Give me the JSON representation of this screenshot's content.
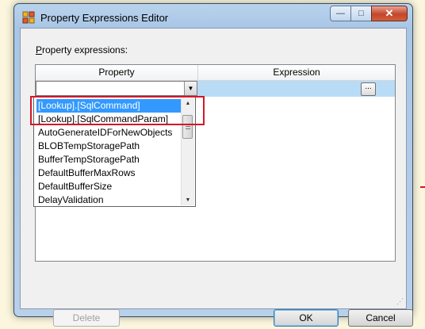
{
  "window": {
    "title": "Property Expressions Editor",
    "caption_buttons": {
      "minimize": "—",
      "maximize": "□",
      "close": "✕"
    }
  },
  "form": {
    "label": "Property expressions:",
    "label_mnemonic": "P"
  },
  "grid": {
    "columns": [
      "Property",
      "Expression"
    ],
    "current_row": {
      "property": "",
      "expression": ""
    },
    "ellipsis_label": "..."
  },
  "dropdown": {
    "items": [
      "[Lookup].[SqlCommand]",
      "[Lookup].[SqlCommandParam]",
      "AutoGenerateIDForNewObjects",
      "BLOBTempStoragePath",
      "BufferTempStoragePath",
      "DefaultBufferMaxRows",
      "DefaultBufferSize",
      "DelayValidation"
    ],
    "selected_index": 0
  },
  "buttons": {
    "delete": "Delete",
    "ok": "OK",
    "cancel": "Cancel"
  },
  "colors": {
    "selection": "#3399ff",
    "row_highlight": "#b9dcf6",
    "annotation": "#d6162a"
  }
}
